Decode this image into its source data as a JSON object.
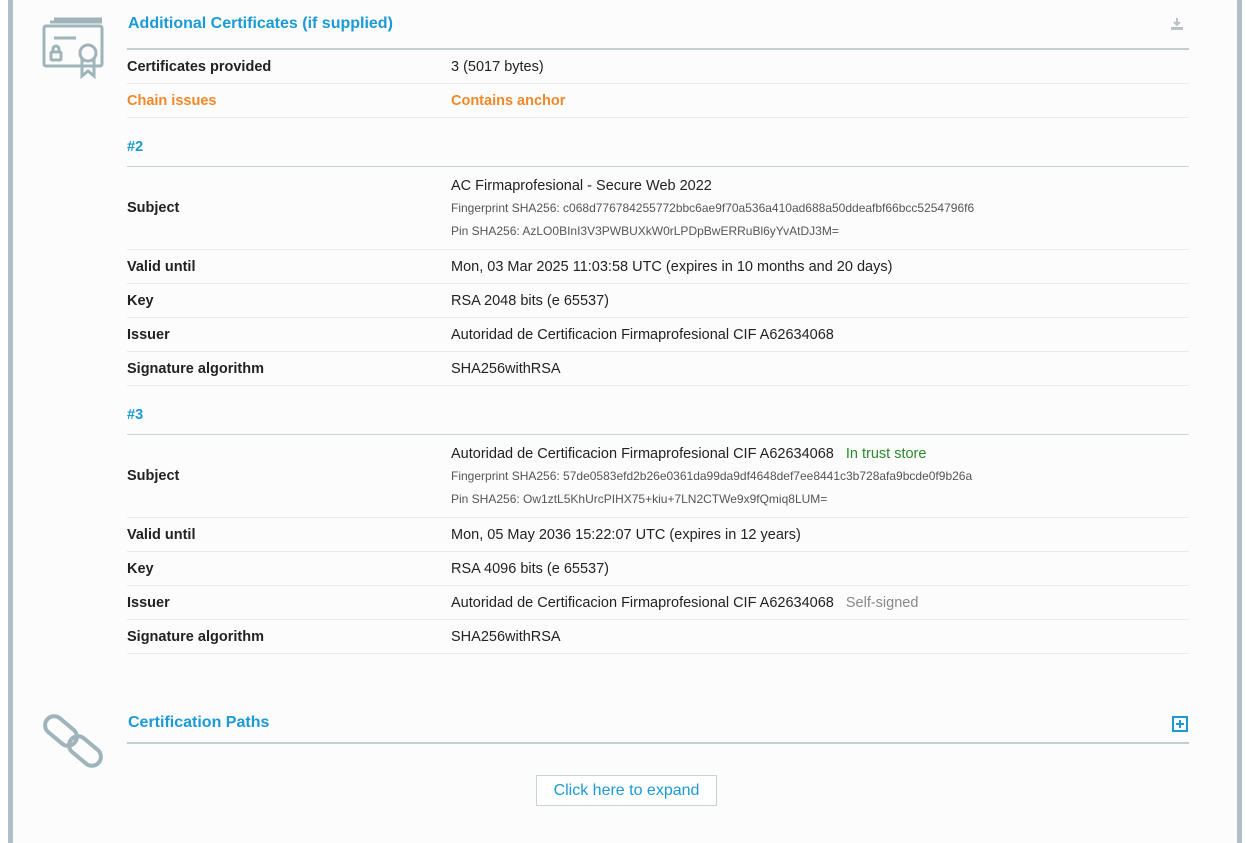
{
  "colors": {
    "accent": "#1b9ad6",
    "warning": "#f0882a",
    "trust": "#2a8a2a",
    "muted": "#888888"
  },
  "additional_certs": {
    "title": "Additional Certificates (if supplied)",
    "icon": "certificate-icon",
    "download_icon": "download-icon",
    "rows": [
      {
        "label": "Certificates provided",
        "value": "3 (5017 bytes)"
      },
      {
        "label": "Chain issues",
        "value": "Contains anchor"
      }
    ],
    "certs": [
      {
        "heading": "#2",
        "subject": "AC Firmaprofesional - Secure Web 2022",
        "subject_badge": "",
        "fingerprint": "Fingerprint SHA256: c068d776784255772bbc6ae9f70a536a410ad688a50ddeafbf66bcc5254796f6",
        "pin": "Pin SHA256: AzLO0BInI3V3PWBUXkW0rLPDpBwERRuBl6yYvAtDJ3M=",
        "valid_until": "Mon, 03 Mar 2025 11:03:58 UTC (expires in 10 months and 20 days)",
        "key": "RSA 2048 bits (e 65537)",
        "issuer": "Autoridad de Certificacion Firmaprofesional CIF A62634068",
        "issuer_badge": "",
        "sig_alg": "SHA256withRSA"
      },
      {
        "heading": "#3",
        "subject": "Autoridad de Certificacion Firmaprofesional CIF A62634068",
        "subject_badge": "In trust store",
        "fingerprint": "Fingerprint SHA256: 57de0583efd2b26e0361da99da9df4648def7ee8441c3b728afa9bcde0f9b26a",
        "pin": "Pin SHA256: Ow1ztL5KhUrcPIHX75+kiu+7LN2CTWe9x9fQmiq8LUM=",
        "valid_until": "Mon, 05 May 2036 15:22:07 UTC (expires in 12 years)",
        "key": "RSA 4096 bits (e 65537)",
        "issuer": "Autoridad de Certificacion Firmaprofesional CIF A62634068",
        "issuer_badge": "Self-signed",
        "sig_alg": "SHA256withRSA"
      }
    ],
    "labels": {
      "subject": "Subject",
      "valid_until": "Valid until",
      "key": "Key",
      "issuer": "Issuer",
      "sig_alg": "Signature algorithm"
    }
  },
  "cert_paths": {
    "title": "Certification Paths",
    "icon": "chain-link-icon",
    "expand_icon": "plus-box-icon",
    "expand_button": "Click here to expand"
  }
}
